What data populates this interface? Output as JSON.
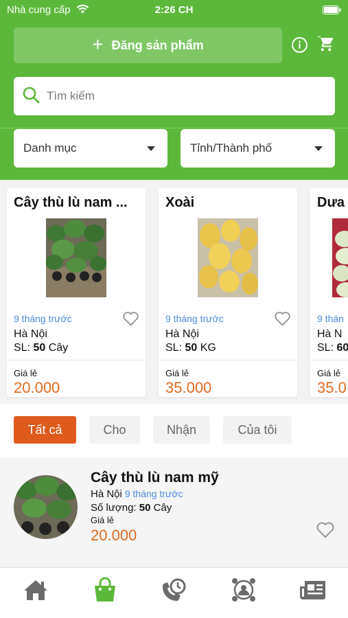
{
  "status_bar": {
    "carrier": "Nhà cung cấp",
    "time": "2:26 CH"
  },
  "header": {
    "post_button_label": "Đăng sản phẩm",
    "search_placeholder": "Tìm kiếm",
    "category_select": "Danh mục",
    "province_select": "Tỉnh/Thành phố"
  },
  "products": [
    {
      "title": "Cây thù lù nam ...",
      "time": "9 tháng trước",
      "location": "Hà Nội",
      "qty_prefix": "SL: ",
      "qty": "50",
      "unit": "Cây",
      "price_label": "Giá lẻ",
      "price": "20.000",
      "image": "plant-seedlings"
    },
    {
      "title": "Xoài",
      "time": "9 tháng trước",
      "location": "Hà Nội",
      "qty_prefix": "SL: ",
      "qty": "50",
      "unit": "KG",
      "price_label": "Giá lẻ",
      "price": "35.000",
      "image": "mangoes"
    },
    {
      "title": "Dưa",
      "time": "9 thán",
      "location": "Hà N",
      "qty_prefix": "SL: ",
      "qty": "60",
      "unit": "",
      "price_label": "Giá lẻ",
      "price": "35.0",
      "image": "melons"
    }
  ],
  "tabs": [
    {
      "label": "Tất cả",
      "active": true
    },
    {
      "label": "Cho",
      "active": false
    },
    {
      "label": "Nhận",
      "active": false
    },
    {
      "label": "Của tôi",
      "active": false
    }
  ],
  "list": [
    {
      "title": "Cây thù lù nam mỹ",
      "location": "Hà Nội",
      "time": "9 tháng trước",
      "qty_label": "Số lượng: ",
      "qty": "50",
      "unit": "Cây",
      "price_label": "Giá lẻ",
      "price": "20.000"
    }
  ],
  "bottom_nav": [
    {
      "icon": "home-icon",
      "active": false
    },
    {
      "icon": "shopping-bag-icon",
      "active": true
    },
    {
      "icon": "phone-history-icon",
      "active": false
    },
    {
      "icon": "contacts-network-icon",
      "active": false
    },
    {
      "icon": "news-icon",
      "active": false
    }
  ],
  "colors": {
    "brand_green": "#5cb83a",
    "accent_orange": "#de5a1d",
    "price_orange": "#e06a1f",
    "link_blue": "#4a8be0",
    "nav_gray": "#6b6b6b"
  }
}
